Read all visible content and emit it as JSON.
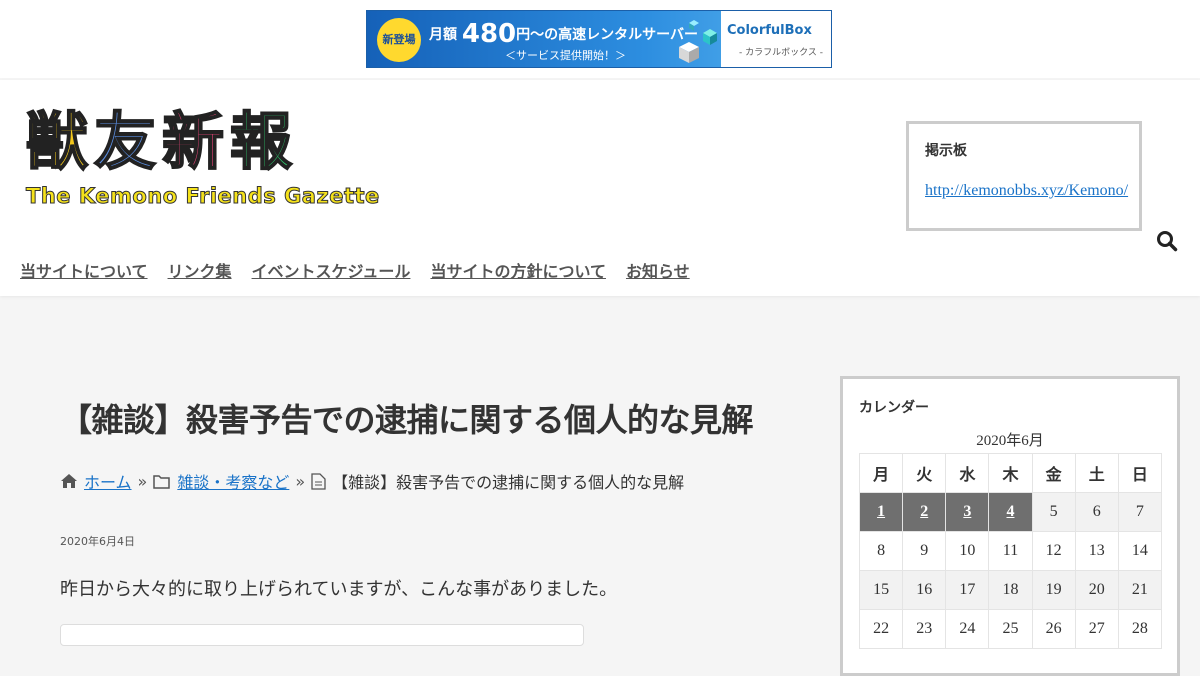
{
  "ad": {
    "badge": "新登場",
    "line1_prefix": "月額",
    "line1_price": "480",
    "line1_suffix": "円～の高速レンタルサーバー",
    "line2": "＜サービス提供開始！＞",
    "brand": "ColorfulBox",
    "brand_sub": "- カラフルボックス -"
  },
  "logo": {
    "kanji": [
      "獣",
      "友",
      "新",
      "報"
    ],
    "kanji_colors": [
      "#f3c81c",
      "#5b8fe3",
      "#f0457b",
      "#2ec46a"
    ],
    "subtitle": "The Kemono Friends Gazette"
  },
  "bbs": {
    "title": "掲示板",
    "link": "http://kemonobbs.xyz/Kemono/"
  },
  "nav": [
    "当サイトについて",
    "リンク集",
    "イベントスケジュール",
    "当サイトの方針について",
    "お知らせ"
  ],
  "article": {
    "title": "【雑談】殺害予告での逮捕に関する個人的な見解",
    "breadcrumb": {
      "home": "ホーム",
      "category": "雑談・考察など",
      "current": "【雑談】殺害予告での逮捕に関する個人的な見解"
    },
    "date": "2020年6月4日",
    "text": "昨日から大々的に取り上げられていますが、こんな事がありました。"
  },
  "calendar": {
    "title": "カレンダー",
    "caption": "2020年6月",
    "weekdays": [
      "月",
      "火",
      "水",
      "木",
      "金",
      "土",
      "日"
    ],
    "weeks": [
      [
        "1",
        "2",
        "3",
        "4",
        "5",
        "6",
        "7"
      ],
      [
        "8",
        "9",
        "10",
        "11",
        "12",
        "13",
        "14"
      ],
      [
        "15",
        "16",
        "17",
        "18",
        "19",
        "20",
        "21"
      ],
      [
        "22",
        "23",
        "24",
        "25",
        "26",
        "27",
        "28"
      ]
    ],
    "linked_days": [
      "1",
      "2",
      "3",
      "4"
    ]
  },
  "colors": {
    "link": "#1a73c8",
    "calendar_highlight": "#6f6f6f"
  }
}
